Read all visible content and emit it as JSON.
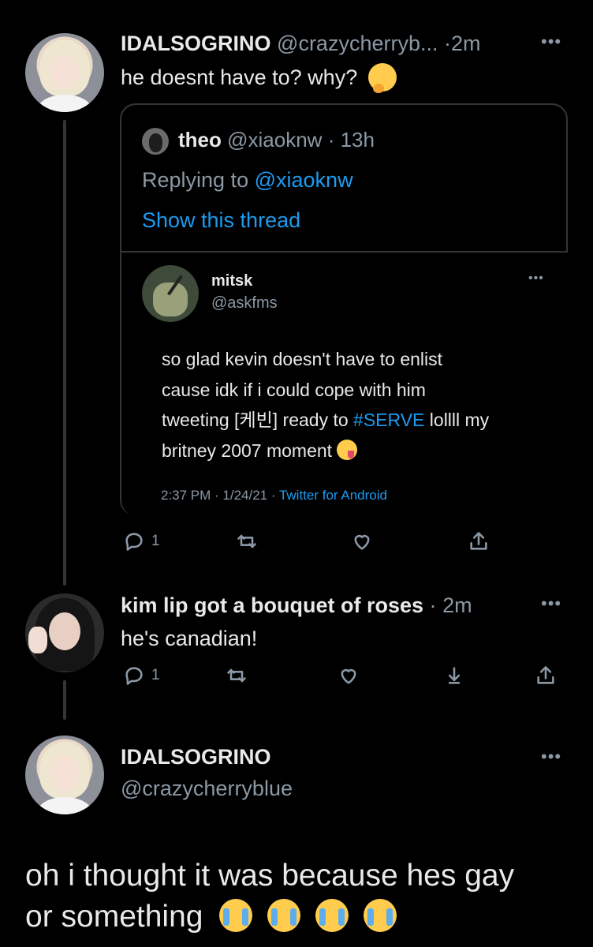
{
  "tweet1": {
    "display_name": "IDALSOGRINO",
    "handle": "@crazycherryb...",
    "sep": "·",
    "time": "2m",
    "text": "he doesnt have to? why?",
    "emoji": "thinking-face",
    "quoted": {
      "name": "theo",
      "handle": "@xiaoknw",
      "time": "13h",
      "replying_prefix": "Replying to",
      "replying_handle": "@xiaoknw",
      "show_thread": "Show this thread",
      "embedded": {
        "name": "mitsk",
        "handle": "@askfms",
        "lines": [
          "so glad kevin doesn't have to enlist",
          "cause idk if i could cope with him",
          "tweeting [케빈] ready to ",
          "britney 2007 moment"
        ],
        "hashtag": "#SERVE",
        "after_hashtag": " lollll my",
        "emoji": "zany-face",
        "timestamp": "2:37 PM · 1/24/21 ·",
        "source": "Twitter for Android"
      }
    },
    "reply_count": "1"
  },
  "tweet2": {
    "display_name": "kim lip got a bouquet of roses",
    "sep": "·",
    "time": "2m",
    "text": "he's canadian!",
    "reply_count": "1"
  },
  "tweet3": {
    "display_name": "IDALSOGRINO",
    "handle": "@crazycherryblue",
    "text_line1": "oh i thought it was because hes gay",
    "text_line2": "or something",
    "emojis": [
      "loudly-crying-face",
      "loudly-crying-face",
      "loudly-crying-face",
      "loudly-crying-face"
    ]
  },
  "colors": {
    "background": "#000000",
    "text": "#e7e9ea",
    "muted": "#8b98a5",
    "accent": "#1d9bf0",
    "border": "#333639"
  }
}
